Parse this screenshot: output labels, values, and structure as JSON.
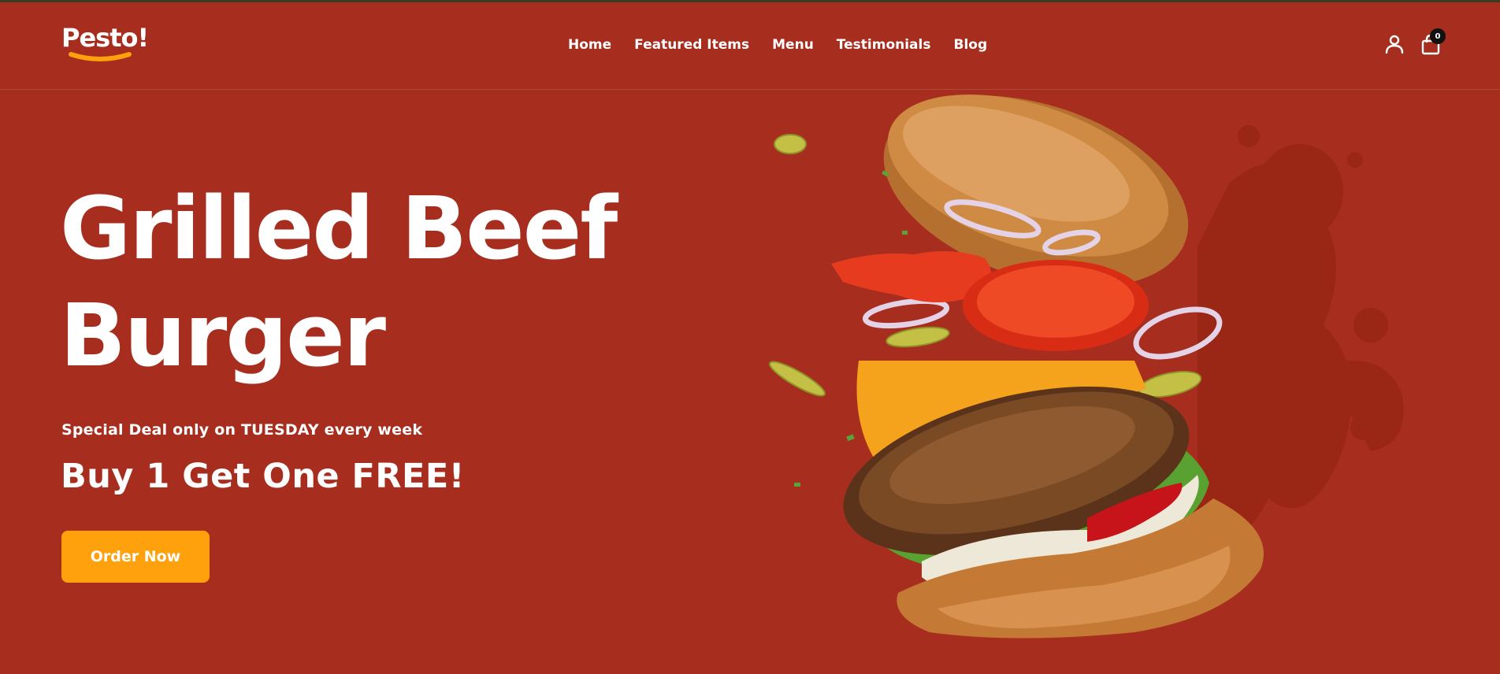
{
  "brand": {
    "name": "Pesto!",
    "accent_color": "#ffa10d",
    "background_color": "#a72d1e"
  },
  "nav": {
    "items": [
      {
        "label": "Home"
      },
      {
        "label": "Featured Items"
      },
      {
        "label": "Menu"
      },
      {
        "label": "Testimonials"
      },
      {
        "label": "Blog"
      }
    ]
  },
  "header_actions": {
    "user_icon": "user-icon",
    "cart_icon": "shopping-bag-icon",
    "cart_count": "0"
  },
  "hero": {
    "title_line1": "Grilled Beef",
    "title_line2": "Burger",
    "deal_text": "Special Deal only on TUESDAY every week",
    "offer_text": "Buy 1 Get One FREE!",
    "cta_label": "Order Now",
    "image_icon": "burger-illustration"
  }
}
